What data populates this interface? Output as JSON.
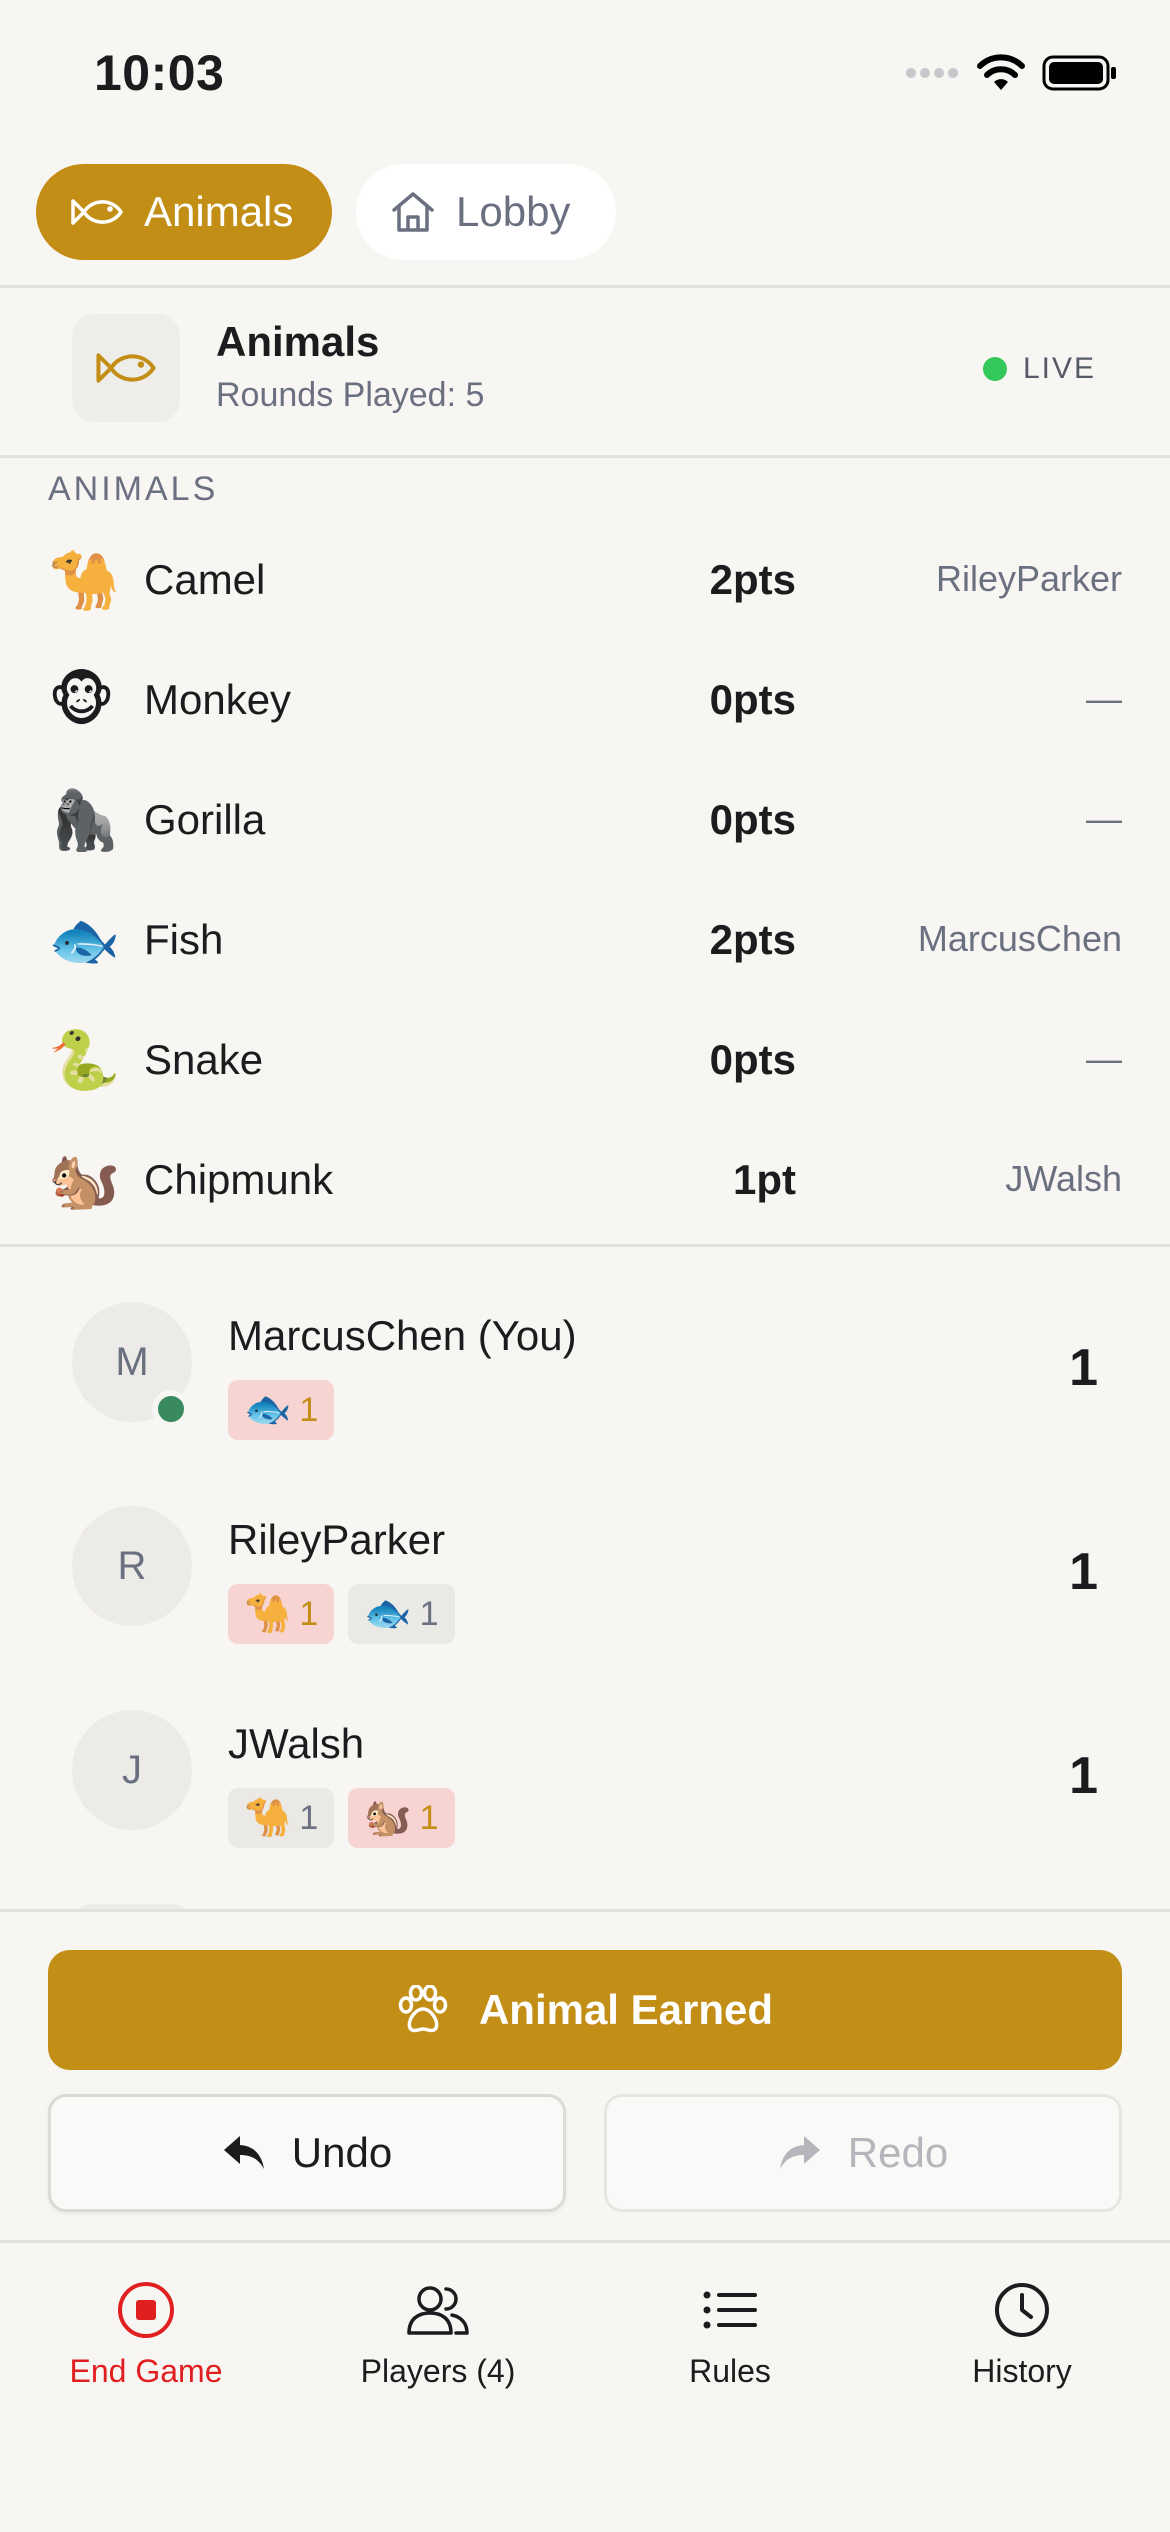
{
  "status_bar": {
    "time": "10:03"
  },
  "tabs": [
    {
      "label": "Animals",
      "icon": "fish-icon",
      "active": true
    },
    {
      "label": "Lobby",
      "icon": "home-icon",
      "active": false
    }
  ],
  "game": {
    "title": "Animals",
    "subtitle": "Rounds Played: 5",
    "status": "LIVE",
    "status_color": "#34c759"
  },
  "animals_section": {
    "label": "ANIMALS",
    "items": [
      {
        "emoji": "🐪",
        "name": "Camel",
        "points": "2pts",
        "owner": "RileyParker"
      },
      {
        "emoji": "🐵",
        "name": "Monkey",
        "points": "0pts",
        "owner": "—"
      },
      {
        "emoji": "🦍",
        "name": "Gorilla",
        "points": "0pts",
        "owner": "—"
      },
      {
        "emoji": "🐟",
        "name": "Fish",
        "points": "2pts",
        "owner": "MarcusChen"
      },
      {
        "emoji": "🐍",
        "name": "Snake",
        "points": "0pts",
        "owner": "—"
      },
      {
        "emoji": "🐿️",
        "name": "Chipmunk",
        "points": "1pt",
        "owner": "JWalsh"
      }
    ]
  },
  "players": [
    {
      "initial": "M",
      "name": "MarcusChen (You)",
      "score": "1",
      "online": true,
      "chips": [
        {
          "emoji": "🐟",
          "count": "1",
          "highlight": true
        }
      ]
    },
    {
      "initial": "R",
      "name": "RileyParker",
      "score": "1",
      "online": false,
      "chips": [
        {
          "emoji": "🐪",
          "count": "1",
          "highlight": true
        },
        {
          "emoji": "🐟",
          "count": "1",
          "highlight": false
        }
      ]
    },
    {
      "initial": "J",
      "name": "JWalsh",
      "score": "1",
      "online": false,
      "chips": [
        {
          "emoji": "🐪",
          "count": "1",
          "highlight": false
        },
        {
          "emoji": "🐿️",
          "count": "1",
          "highlight": true
        }
      ]
    }
  ],
  "actions": {
    "primary_label": "Animal Earned",
    "undo_label": "Undo",
    "redo_label": "Redo"
  },
  "bottom_nav": [
    {
      "label": "End Game",
      "icon": "stop-icon"
    },
    {
      "label": "Players (4)",
      "icon": "users-icon"
    },
    {
      "label": "Rules",
      "icon": "list-icon"
    },
    {
      "label": "History",
      "icon": "clock-icon"
    }
  ],
  "colors": {
    "accent": "#c28e16",
    "background": "#f8f6f3",
    "danger": "#e02020",
    "online": "#3a8a5f"
  }
}
